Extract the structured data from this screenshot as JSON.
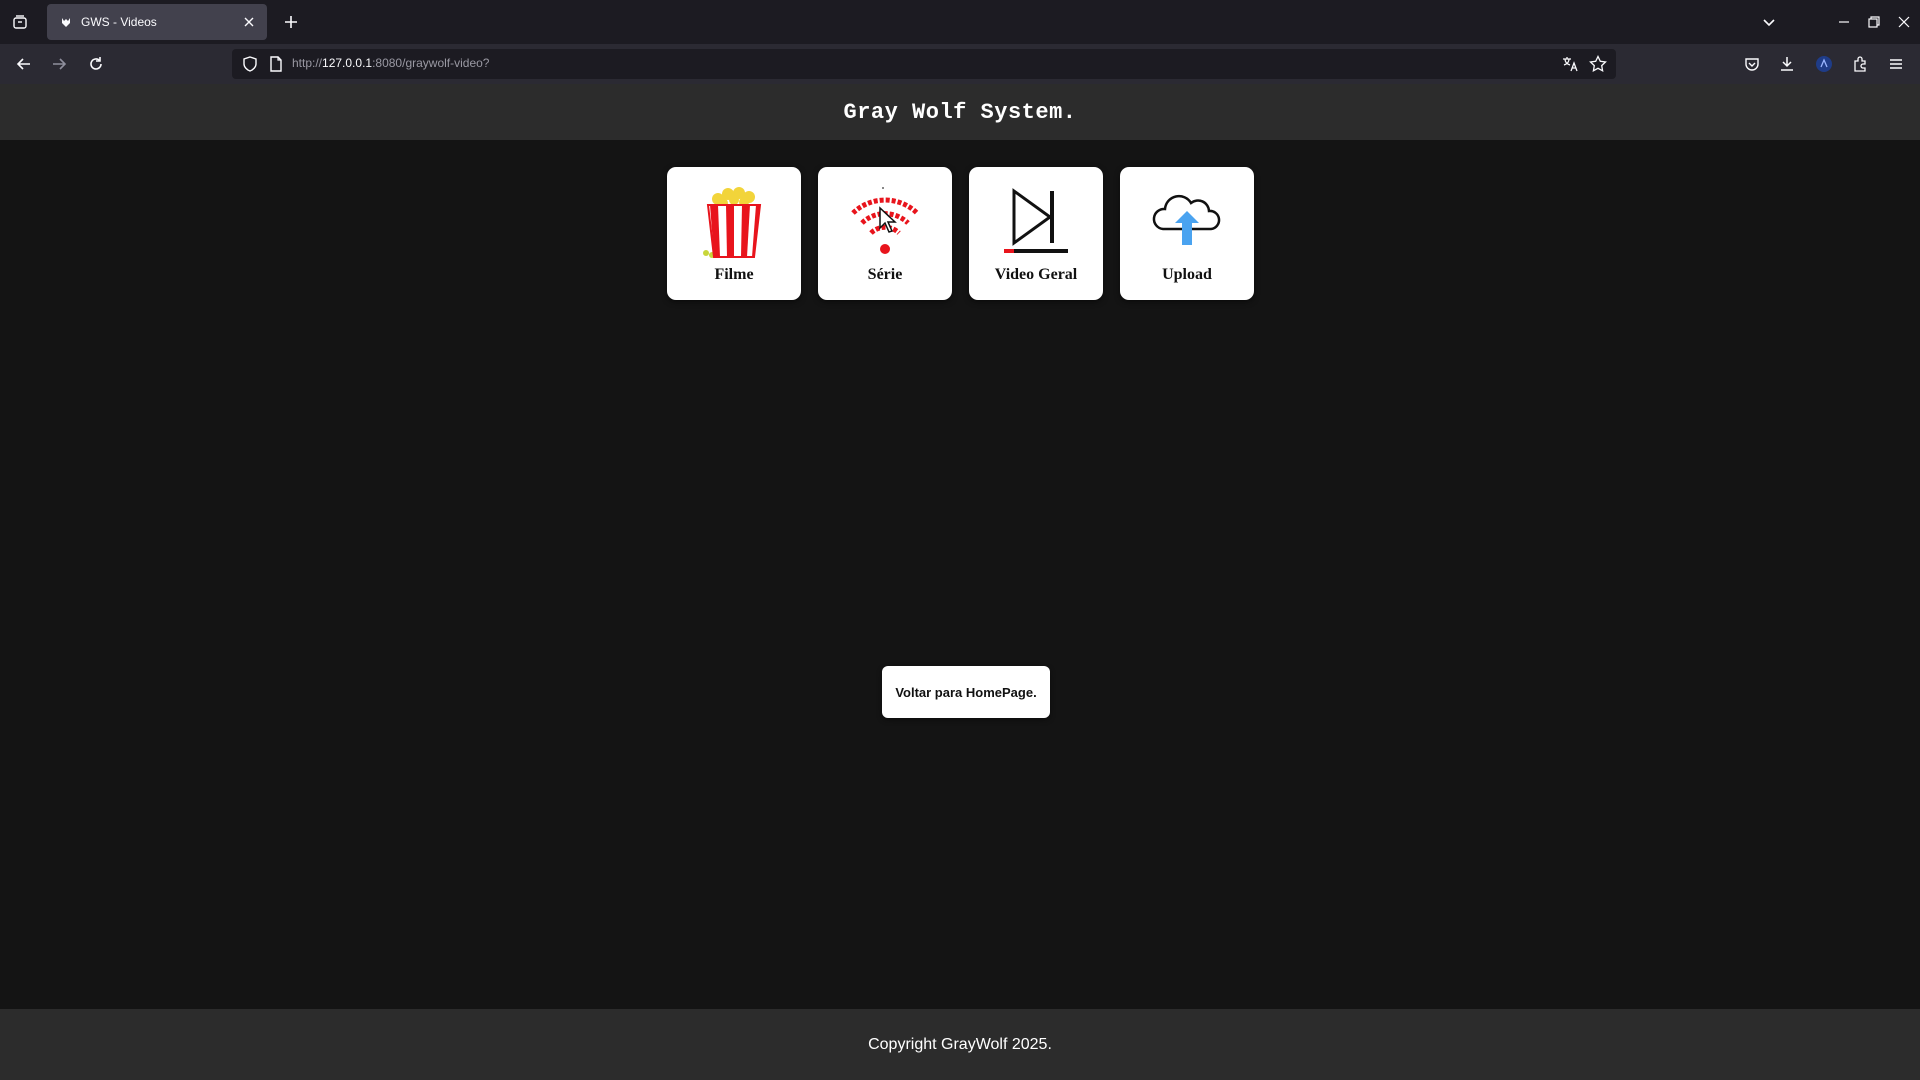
{
  "browser": {
    "tab_title": "GWS - Videos",
    "url_prefix": "http://",
    "url_host": "127.0.0.1",
    "url_rest": ":8080/graywolf-video?"
  },
  "page": {
    "header_title": "Gray Wolf System.",
    "cards": [
      {
        "label": "Filme",
        "icon": "popcorn-icon"
      },
      {
        "label": "Série",
        "icon": "wifi-signal-icon"
      },
      {
        "label": "Video Geral",
        "icon": "skip-play-icon"
      },
      {
        "label": "Upload",
        "icon": "cloud-upload-icon"
      }
    ],
    "home_button": "Voltar para HomePage.",
    "footer": "Copyright GrayWolf 2025."
  },
  "colors": {
    "accent_red": "#e8141c",
    "upload_blue": "#4aa3f0",
    "page_bg": "#141414",
    "bar_bg": "#2c2c2c"
  }
}
